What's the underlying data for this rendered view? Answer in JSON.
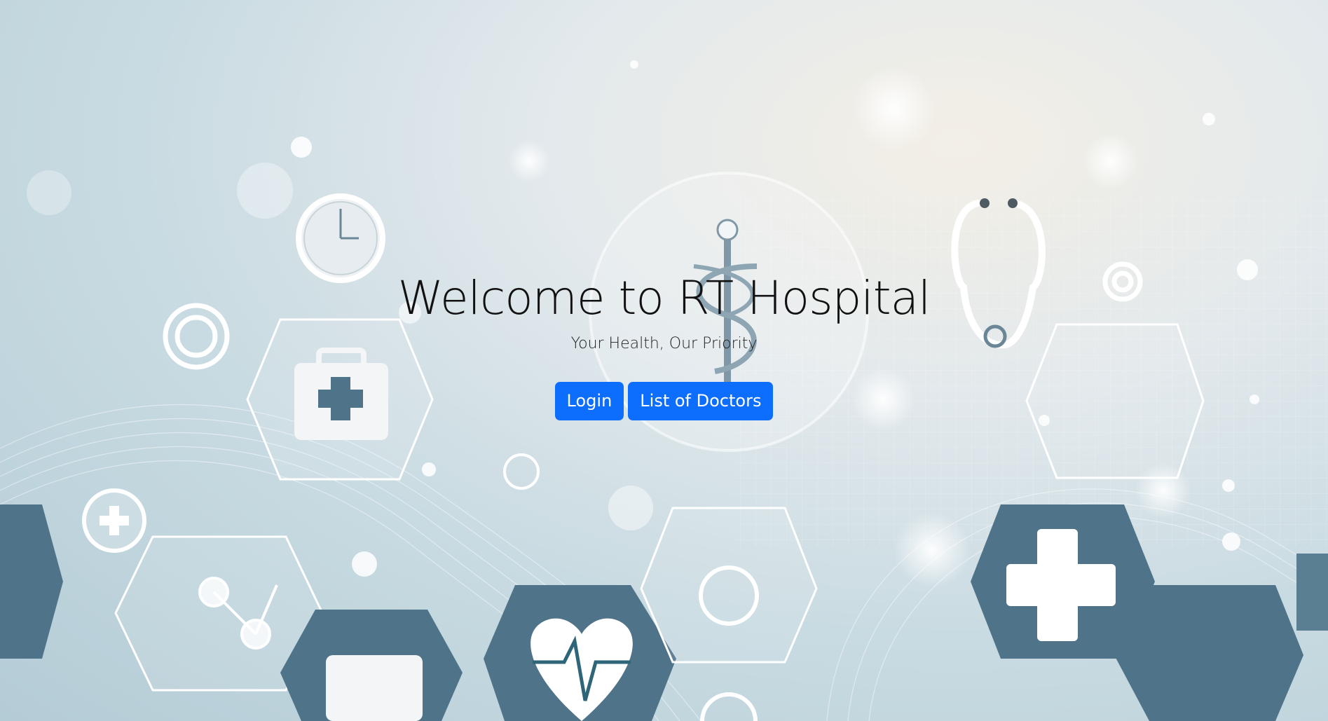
{
  "hero": {
    "title": "Welcome to RT Hospital",
    "subtitle": "Your Health, Our Priority"
  },
  "actions": {
    "login_label": "Login",
    "doctors_label": "List of Doctors"
  },
  "colors": {
    "button_bg": "#0d6efd",
    "button_text": "#ffffff",
    "hex_dark": "#4f7389",
    "hex_line": "#ffffff"
  },
  "background_icons": [
    "clock-icon",
    "medical-kit-icon",
    "caduceus-icon",
    "stethoscope-icon",
    "heartbeat-icon",
    "medical-cross-icon",
    "target-icon"
  ]
}
